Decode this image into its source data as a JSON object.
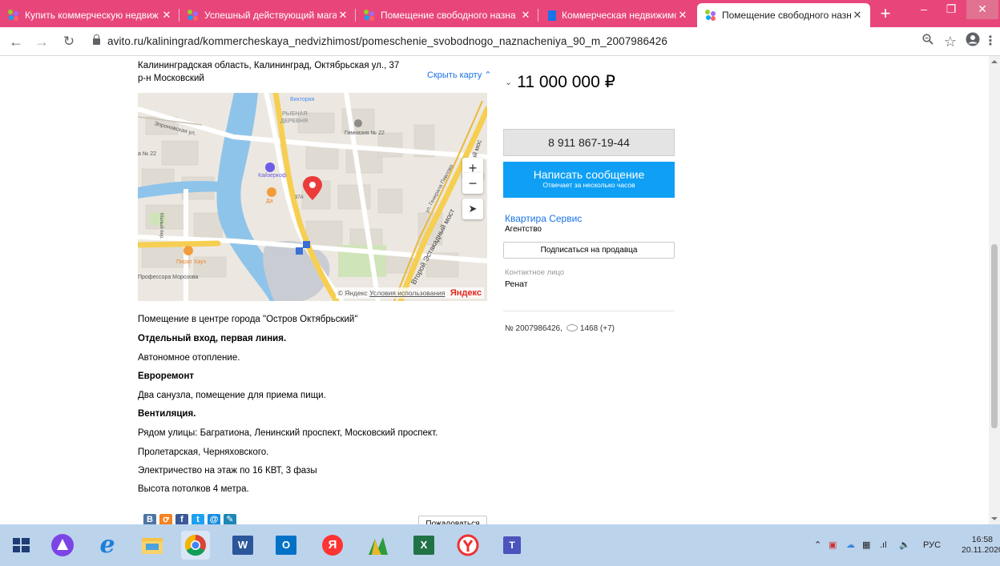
{
  "browser": {
    "tabs": [
      {
        "title": "Купить коммерческую недвиж",
        "favicon": "avito-icon"
      },
      {
        "title": "Успешный действующий магаз",
        "favicon": "avito-icon"
      },
      {
        "title": "Помещение свободного назна",
        "favicon": "avito-icon"
      },
      {
        "title": "Коммерческая недвижимость",
        "favicon": "bookmark-flag-icon"
      },
      {
        "title": "Помещение свободного назна",
        "favicon": "avito-icon",
        "active": true
      }
    ],
    "url": "avito.ru/kaliningrad/kommercheskaya_nedvizhimost/pomeschenie_svobodnogo_naznacheniya_90_m_2007986426",
    "accent": "#e8467a"
  },
  "listing": {
    "address_line1": "Калининградская область, Калининград, Октябрьская ул., 37",
    "address_line2": "р-н Московский",
    "hide_map": "Скрыть карту",
    "map": {
      "labels": {
        "viktoria": "Виктория",
        "street1": "Эпроновская ул.",
        "ryb1": "РЫБНАЯ",
        "ryb2": "ДЕРЕВНЯ",
        "gym": "Гимназия № 22",
        "n22": "а № 22",
        "kaiser": "Кайзеркоф",
        "da": "Да",
        "pirat": "Пират Хауз",
        "morozova": "Профессора Морозова",
        "vtoroy": "Второй Эстакадный мост",
        "pavlova": "ул. Генерала Павлова",
        "estak": "Эстакадный мос",
        "malyi": "Малый пер.",
        "n37a": "37А"
      },
      "zoom_in": "+",
      "zoom_out": "−",
      "copyright": "© Яндекс",
      "terms": "Условия использования",
      "yandex": "Яндекс"
    },
    "description": [
      "Помещение в центре города \"Остров Октябрьский\"",
      "Отдельный вход, первая линия.",
      "Автономное отопление.",
      "Евроремонт",
      "Два санузла, помещение для приема пищи.",
      "Вентиляция.",
      "Рядом улицы: Багратиона, Ленинский проспект, Московский проспект.",
      "Пролетарская, Черняховского.",
      "Электричество на этаж по 16 КВТ, 3 фазы",
      "Высота потолков 4 метра."
    ],
    "complain": "Пожаловаться",
    "price": "11 000 000 ₽",
    "phone": "8 911 867-19-44",
    "message_title": "Написать сообщение",
    "message_sub": "Отвечает за несколько часов",
    "seller_name": "Квартира Сервис",
    "seller_type": "Агентство",
    "subscribe": "Подписаться на продавца",
    "contact_label": "Контактное лицо",
    "contact_name": "Ренат",
    "ad_number": "№ 2007986426,",
    "views": "1468 (+7)"
  },
  "taskbar": {
    "lang": "РУС",
    "time": "16:58",
    "date": "20.11.2020"
  }
}
